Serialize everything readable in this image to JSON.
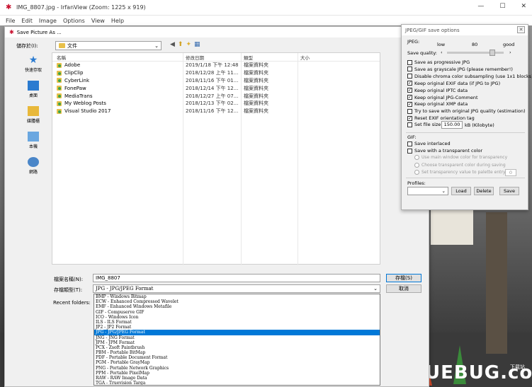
{
  "app": {
    "title": "IMG_8807.jpg - IrfanView (Zoom: 1225 x 919)",
    "menu": [
      "File",
      "Edit",
      "Image",
      "Options",
      "View",
      "Help"
    ],
    "window_controls": [
      "—",
      "☐",
      "✕"
    ]
  },
  "background": {
    "watermark": "UEBUG.com",
    "watermark_sub": "下载站"
  },
  "dialog": {
    "title": "Save Picture As ...",
    "lookin_label": "儲存於(I):",
    "lookin_value": "文件",
    "places": [
      "快速存取",
      "桌面",
      "媒體櫃",
      "本機",
      "網路"
    ],
    "columns": [
      "名稱",
      "修改日期",
      "類型",
      "大小"
    ],
    "files": [
      {
        "name": "Adobe",
        "date": "2019/1/18 下午 12:48",
        "type": "檔案資料夾"
      },
      {
        "name": "ClipClip",
        "date": "2018/12/28 上午 11...",
        "type": "檔案資料夾"
      },
      {
        "name": "CyberLink",
        "date": "2018/11/16 下午 01...",
        "type": "檔案資料夾"
      },
      {
        "name": "FonePaw",
        "date": "2018/12/14 下午 12...",
        "type": "檔案資料夾"
      },
      {
        "name": "MediaTrans",
        "date": "2018/12/27 上午 07...",
        "type": "檔案資料夾"
      },
      {
        "name": "My Weblog Posts",
        "date": "2018/12/13 下午 02...",
        "type": "檔案資料夾"
      },
      {
        "name": "Visual Studio 2017",
        "date": "2018/11/16 下午 12...",
        "type": "檔案資料夾"
      }
    ],
    "filename_label": "檔案名稱(N):",
    "filename_value": "IMG_8807",
    "filetype_label": "存檔類型(T):",
    "filetype_value": "JPG - JPG/JPEG Format",
    "recent_label": "Recent folders:",
    "save_button": "存檔(S)",
    "cancel_button": "取消",
    "type_options": [
      "BMP - Windows Bitmap",
      "ECW - Enhanced Compressed Wavelet",
      "EMF - Enhanced Windows Metafile",
      "GIF - Compuserve GIF",
      "ICO - Windows Icon",
      "ILS - ILS Format",
      "JP2 - JP2 Format",
      "JPG - JPG/JPEG Format",
      "JNG - JNG Format",
      "JPM - JPM Format",
      "PCX - Zsoft Paintbrush",
      "PBM - Portable BitMap",
      "PDF - Portable Document Format",
      "PGM - Portable GrayMap",
      "PNG - Portable Network Graphics",
      "PPM - Portable PixelMap",
      "RAW - RAW Image Data",
      "TGA - Truevision Targa"
    ],
    "selected_type_index": 7
  },
  "options": {
    "title": "JPEG/GIF save options",
    "jpeg_label": "JPEG:",
    "slider_low": "low",
    "slider_value": "80",
    "slider_good": "good",
    "quality_label": "Save quality:",
    "quality_fraction": 0.8,
    "jpeg_checks": [
      {
        "label": "Save as progressive JPG",
        "checked": false
      },
      {
        "label": "Save as grayscale JPG (please remember!)",
        "checked": false
      },
      {
        "label": "Disable chroma color subsampling (use 1x1 blocks)",
        "checked": false
      },
      {
        "label": "Keep original EXIF data (if JPG to JPG)",
        "checked": true
      },
      {
        "label": "Keep original IPTC data",
        "checked": true
      },
      {
        "label": "Keep original JPG-Comment",
        "checked": true
      },
      {
        "label": "Keep original XMP data",
        "checked": true
      },
      {
        "label": "Try to save with original JPG quality (estimation)",
        "checked": false
      },
      {
        "label": "Reset EXIF orientation tag",
        "checked": true
      }
    ],
    "set_file_size_label": "Set file size:",
    "file_size_value": "150.00",
    "file_size_unit": "kB (Kilobyte)",
    "gif_label": "GIF:",
    "gif_checks": [
      {
        "label": "Save interlaced",
        "checked": false
      },
      {
        "label": "Save with a transparent color",
        "checked": false
      }
    ],
    "gif_radios": [
      "Use main window color for transparency",
      "Choose transparent color during saving",
      "Set transparency value to palette entry:"
    ],
    "transparency_value": "0",
    "profiles_label": "Profiles:",
    "load_button": "Load",
    "delete_button": "Delete",
    "save_button": "Save"
  }
}
